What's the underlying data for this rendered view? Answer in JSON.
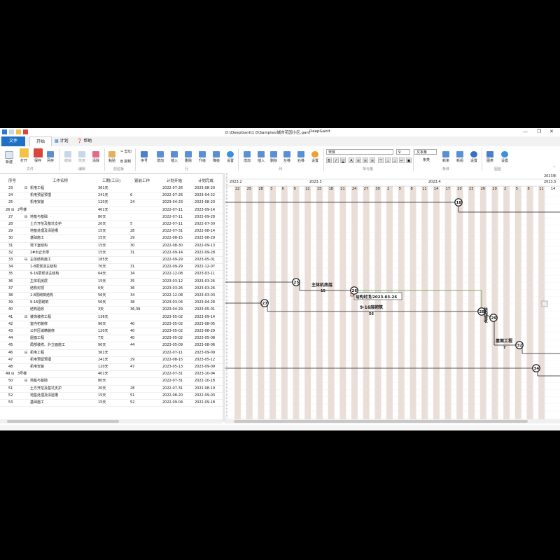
{
  "titlebar": {
    "path": "D:\\DeepGantt1.0\\Samples\\城市花园小区.gant",
    "app": "DeepGantt"
  },
  "tabs": {
    "file": "文件",
    "start": "开始",
    "plan": "计划",
    "help": "帮助"
  },
  "ribbon": {
    "new": "新建",
    "open": "打开",
    "save": "保存",
    "saveas": "另存",
    "undo": "撤销",
    "redo": "恢复",
    "clear": "清除",
    "paste": "粘贴",
    "cut": "剪切",
    "copy": "复制",
    "seq": "序号",
    "addrow": "增加",
    "insertrow": "插入",
    "deleterow": "删除",
    "upgrade": "升级",
    "downgrade": "降级",
    "settings1": "设置",
    "addcol": "增加",
    "insertcol": "插入",
    "deletecol": "删除",
    "leftshift": "左移",
    "rightshift": "右移",
    "settings2": "设置",
    "font_name": "宋体",
    "font_size": "9",
    "text_style": "文本条",
    "bar_label": "条类",
    "new_bar": "新条",
    "newmerge": "新组",
    "settings3": "设置",
    "chart_type": "图类",
    "settings4": "设置",
    "groups": {
      "file": "文件",
      "edit": "编辑",
      "clipboard": "剪贴板",
      "row": "行",
      "col": "列",
      "cell": "单元格",
      "bar": "条体",
      "chart": "图型"
    }
  },
  "table": {
    "headers": [
      "序号",
      "工作名称",
      "工期(工日)",
      "紧前工作",
      "计划开始",
      "计划完成"
    ],
    "rows": [
      {
        "id": "23",
        "g": true,
        "name": "机电工程",
        "dur": "361天",
        "pre": "",
        "s": "2022-07-26",
        "f": "2023-08-20"
      },
      {
        "id": "24",
        "g": false,
        "name": "机电预留预埋",
        "dur": "241天",
        "pre": "6",
        "s": "2022-07-26",
        "f": "2023-04-22"
      },
      {
        "id": "25",
        "g": false,
        "name": "机电安装",
        "dur": "120天",
        "pre": "24",
        "s": "2023-04-23",
        "f": "2023-08-20"
      },
      {
        "id": "26",
        "g": true,
        "name": "2号楼",
        "dur": "401天",
        "pre": "",
        "s": "2022-07-11",
        "f": "2023-09-14"
      },
      {
        "id": "27",
        "g": true,
        "name": "地基与基础",
        "dur": "80天",
        "pre": "",
        "s": "2022-07-11",
        "f": "2022-09-28"
      },
      {
        "id": "28",
        "g": false,
        "name": "土方开挖及基坑支护",
        "dur": "20天",
        "pre": "5",
        "s": "2022-07-11",
        "f": "2022-07-30"
      },
      {
        "id": "29",
        "g": false,
        "name": "地基处理及清验槽",
        "dur": "15天",
        "pre": "28",
        "s": "2022-07-31",
        "f": "2022-08-14"
      },
      {
        "id": "30",
        "g": false,
        "name": "基础施工",
        "dur": "15天",
        "pre": "29",
        "s": "2022-08-15",
        "f": "2022-08-29"
      },
      {
        "id": "31",
        "g": false,
        "name": "地下室结构",
        "dur": "15天",
        "pre": "30",
        "s": "2022-08-30",
        "f": "2022-09-13"
      },
      {
        "id": "32",
        "g": false,
        "name": "2#出正负零",
        "dur": "15天",
        "pre": "31",
        "s": "2022-09-14",
        "f": "2022-09-28"
      },
      {
        "id": "33",
        "g": true,
        "name": "主体结构施工",
        "dur": "185天",
        "pre": "",
        "s": "2022-09-29",
        "f": "2023-05-01"
      },
      {
        "id": "34",
        "g": false,
        "name": "1-8层现浇主结构",
        "dur": "70天",
        "pre": "31",
        "s": "2022-09-29",
        "f": "2022-12-07"
      },
      {
        "id": "35",
        "g": false,
        "name": "9-16层现浇主结构",
        "dur": "64天",
        "pre": "34",
        "s": "2022-12-08",
        "f": "2023-03-11"
      },
      {
        "id": "36",
        "g": false,
        "name": "主体机房层",
        "dur": "15天",
        "pre": "35",
        "s": "2023-03-12",
        "f": "2023-03-26"
      },
      {
        "id": "37",
        "g": false,
        "name": "结构封顶",
        "dur": "0天",
        "pre": "36",
        "s": "2023-03-26",
        "f": "2023-03-26"
      },
      {
        "id": "38",
        "g": false,
        "name": "1-8层砌筑结构",
        "dur": "56天",
        "pre": "34",
        "s": "2022-12-08",
        "f": "2023-03-03"
      },
      {
        "id": "39",
        "g": false,
        "name": "9-16层砌筑",
        "dur": "56天",
        "pre": "38",
        "s": "2023-03-04",
        "f": "2023-04-28"
      },
      {
        "id": "40",
        "g": false,
        "name": "结构验收",
        "dur": "3天",
        "pre": "36,39",
        "s": "2023-04-29",
        "f": "2023-05-01"
      },
      {
        "id": "41",
        "g": true,
        "name": "装饰装修工程",
        "dur": "136天",
        "pre": "",
        "s": "2023-05-02",
        "f": "2023-09-14"
      },
      {
        "id": "42",
        "g": false,
        "name": "室内初装修",
        "dur": "96天",
        "pre": "40",
        "s": "2023-05-02",
        "f": "2023-08-05"
      },
      {
        "id": "43",
        "g": false,
        "name": "公共区域精装修",
        "dur": "120天",
        "pre": "40",
        "s": "2023-05-02",
        "f": "2023-08-29"
      },
      {
        "id": "44",
        "g": false,
        "name": "屋面工程",
        "dur": "7天",
        "pre": "40",
        "s": "2023-05-02",
        "f": "2023-05-08"
      },
      {
        "id": "45",
        "g": false,
        "name": "局部装修、外立面施工",
        "dur": "90天",
        "pre": "44",
        "s": "2023-05-09",
        "f": "2023-08-06"
      },
      {
        "id": "46",
        "g": true,
        "name": "机电工程",
        "dur": "361天",
        "pre": "",
        "s": "2022-07-11",
        "f": "2023-09-09"
      },
      {
        "id": "47",
        "g": false,
        "name": "机电预留预埋",
        "dur": "241天",
        "pre": "29",
        "s": "2022-08-15",
        "f": "2023-05-12"
      },
      {
        "id": "48",
        "g": false,
        "name": "机电安装",
        "dur": "120天",
        "pre": "47",
        "s": "2023-05-13",
        "f": "2023-09-09"
      },
      {
        "id": "49",
        "g": true,
        "name": "3号楼",
        "dur": "401天",
        "pre": "",
        "s": "2022-07-31",
        "f": "2023-10-04"
      },
      {
        "id": "50",
        "g": true,
        "name": "地基与基础",
        "dur": "80天",
        "pre": "",
        "s": "2022-07-31",
        "f": "2022-10-18"
      },
      {
        "id": "51",
        "g": false,
        "name": "土方开挖及基坑支护",
        "dur": "20天",
        "pre": "28",
        "s": "2022-07-31",
        "f": "2022-08-19"
      },
      {
        "id": "52",
        "g": false,
        "name": "地基处理及清验槽",
        "dur": "15天",
        "pre": "51",
        "s": "2022-08-20",
        "f": "2022-09-03"
      },
      {
        "id": "53",
        "g": false,
        "name": "基础施工",
        "dur": "15天",
        "pre": "52",
        "s": "2022-09-04",
        "f": "2022-09-18"
      }
    ]
  },
  "gantt": {
    "years": [
      "2023年",
      "2023.5"
    ],
    "months": [
      "2023.2",
      "2023.3",
      "2023.4"
    ],
    "days": [
      "22",
      "25",
      "28",
      "3",
      "6",
      "9",
      "12",
      "15",
      "18",
      "21",
      "24",
      "27",
      "30",
      "2",
      "5",
      "8",
      "11",
      "14",
      "17",
      "20",
      "23",
      "26",
      "29",
      "2",
      "5",
      "8",
      "11",
      "14"
    ],
    "nodes": [
      "18",
      "25",
      "26",
      "27",
      "28",
      "29",
      "32",
      "34"
    ],
    "labels": {
      "main_room": "主体机房层",
      "main_room_dur": "15",
      "topping": "结构封顶/2023-03-26",
      "masonry": "9-16层砌筑",
      "masonry_dur": "56",
      "roof": "屋面工程",
      "roof_dur": "7",
      "accept": "结构验收"
    }
  }
}
